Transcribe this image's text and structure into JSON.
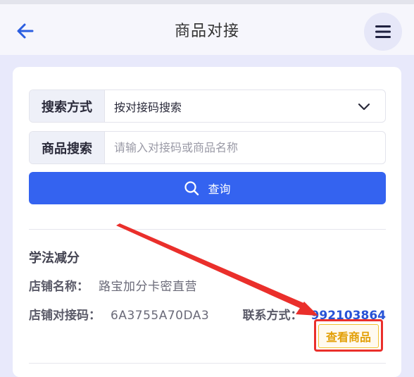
{
  "header": {
    "title": "商品对接",
    "back_icon": "arrow-left-icon",
    "menu_icon": "hamburger-menu-icon"
  },
  "search_form": {
    "mode_label": "搜索方式",
    "mode_value": "按对接码搜索",
    "product_label": "商品搜索",
    "product_value": "",
    "product_placeholder": "请输入对接码或商品名称",
    "query_label": "查询"
  },
  "result": {
    "title": "学法减分",
    "shop_name_label": "店铺名称：",
    "shop_name_value": "路宝加分卡密直营",
    "shop_code_label": "店铺对接码：",
    "shop_code_value": "6A3755A70DA3",
    "contact_label": "联系方式：",
    "contact_value": "992103864",
    "view_goods_label": "查看商品"
  },
  "colors": {
    "accent": "#3463f0",
    "contact_link": "#2853d6",
    "highlight_red": "#ea2f2b",
    "view_button_text": "#e3a008"
  }
}
